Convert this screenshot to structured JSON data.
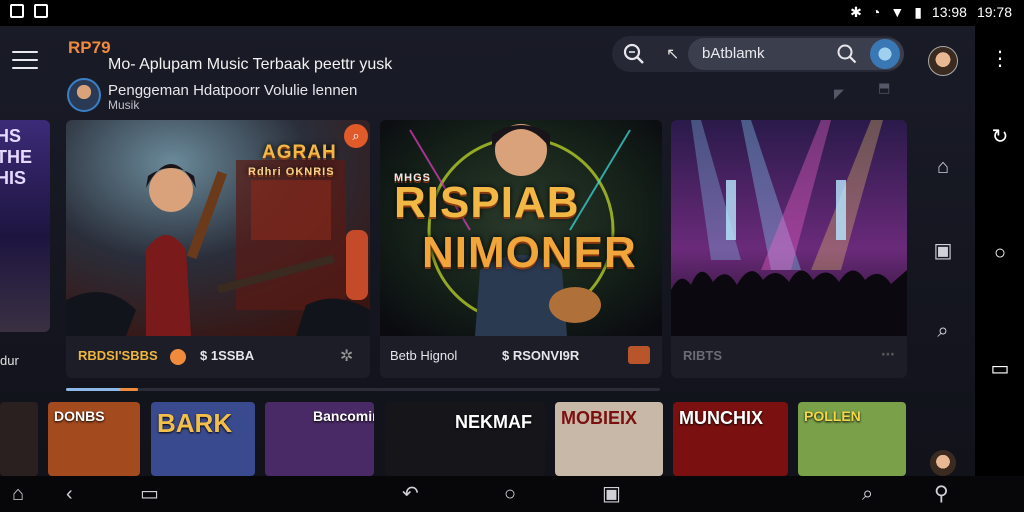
{
  "status_bar": {
    "clock": "13:98",
    "time_secondary": "19:78"
  },
  "header": {
    "brand": "RP79",
    "title": "Mo- Aplupam Music Terbaak peettr yusk",
    "subtitle_line1": "Penggeman Hdatpoorr Volulie lennen",
    "subtitle_line2": "Musik"
  },
  "search": {
    "value": "bAtblamk"
  },
  "left_peek": {
    "art_text": "HS THE HIS",
    "caption": "dur"
  },
  "cards": [
    {
      "art_title": "AGRAH",
      "art_subtitle": "Rdhri OKNRIS",
      "footer_primary": "RBDSI'SBBS",
      "footer_secondary": "$ 1SSBA"
    },
    {
      "art_title": "RISPIAB",
      "art_title2": "NIMONER",
      "art_tag": "MHGS",
      "footer_primary": "Betb Hignol",
      "footer_secondary": "$ RSONVI9R"
    },
    {
      "footer_primary": "RIBTS"
    }
  ],
  "thumbnails": [
    {
      "label": "",
      "color": "#2b2020"
    },
    {
      "label": "DONBS",
      "color": "#a34a1e"
    },
    {
      "label": "BARK",
      "color": "#3a4a8e"
    },
    {
      "label": "Bancomin",
      "color": "#4a2a66"
    },
    {
      "label": "NEKMAF",
      "color": "#16161a"
    },
    {
      "label": "MOBIEIX",
      "color": "#c8b8a8"
    },
    {
      "label": "MUNCHIX",
      "color": "#7a1010"
    },
    {
      "label": "POLLEN",
      "color": "#7aa04a"
    }
  ],
  "colors": {
    "accent_orange": "#f08a3c",
    "accent_gold": "#f0b53d",
    "background": "#11121a"
  }
}
